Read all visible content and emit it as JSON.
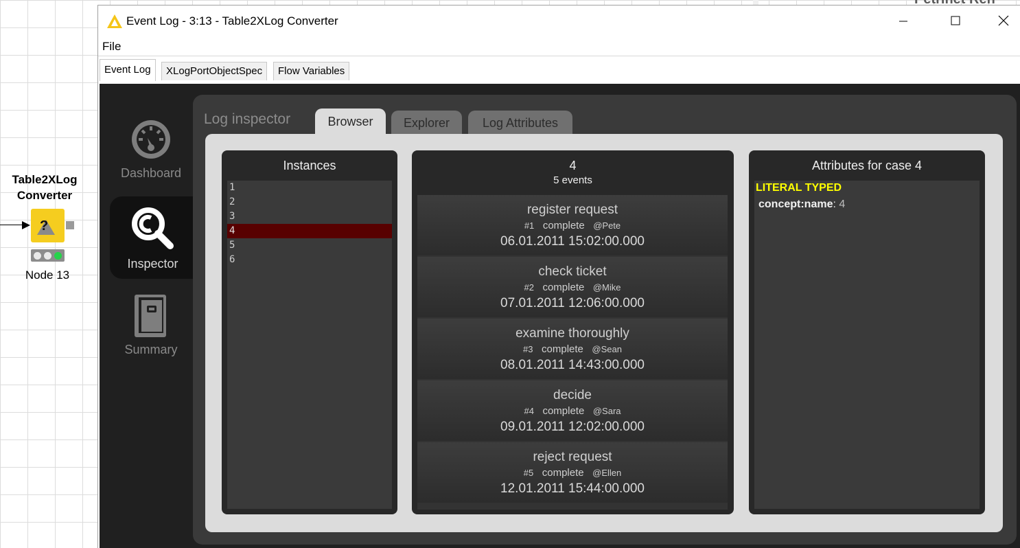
{
  "workflow": {
    "node_title": [
      "Table2XLog",
      "Converter"
    ],
    "node_label": "Node 13",
    "node_icon_glyph": "?"
  },
  "background_window": {
    "partial_title": "Petrinet Ren"
  },
  "window": {
    "title": "Event Log - 3:13 - Table2XLog Converter",
    "controls": {
      "minimize": "minimize-icon",
      "maximize": "maximize-icon",
      "close": "close-icon"
    }
  },
  "menu": {
    "file": "File"
  },
  "swing_tabs": [
    "Event Log",
    "XLogPortObjectSpec",
    "Flow Variables"
  ],
  "sidebar": {
    "items": [
      {
        "label": "Dashboard",
        "icon": "dashboard-gauge-icon"
      },
      {
        "label": "Inspector",
        "icon": "magnifier-icon",
        "active": true
      },
      {
        "label": "Summary",
        "icon": "notebook-icon"
      }
    ]
  },
  "inspector": {
    "panel_title": "Log inspector",
    "tabs": [
      "Browser",
      "Explorer",
      "Log Attributes"
    ],
    "instances": {
      "header": "Instances",
      "items": [
        "1",
        "2",
        "3",
        "4",
        "5",
        "6"
      ],
      "selected": "4"
    },
    "case": {
      "title": "4",
      "subtitle": "5 events",
      "events": [
        {
          "name": "register request",
          "num": "#1",
          "status": "complete",
          "resource": "@Pete",
          "time": "06.01.2011 15:02:00.000"
        },
        {
          "name": "check ticket",
          "num": "#2",
          "status": "complete",
          "resource": "@Mike",
          "time": "07.01.2011 12:06:00.000"
        },
        {
          "name": "examine thoroughly",
          "num": "#3",
          "status": "complete",
          "resource": "@Sean",
          "time": "08.01.2011 14:43:00.000"
        },
        {
          "name": "decide",
          "num": "#4",
          "status": "complete",
          "resource": "@Sara",
          "time": "09.01.2011 12:02:00.000"
        },
        {
          "name": "reject request",
          "num": "#5",
          "status": "complete",
          "resource": "@Ellen",
          "time": "12.01.2011 15:44:00.000"
        }
      ]
    },
    "attributes": {
      "header": "Attributes for case 4",
      "section": "LITERAL TYPED",
      "key": "concept:name",
      "separator": ":",
      "value": "4"
    }
  },
  "colors": {
    "node_yellow": "#f5cd1f",
    "selected_row": "#580000",
    "attr_heading": "#ffff00",
    "panel_dark": "#202020"
  }
}
